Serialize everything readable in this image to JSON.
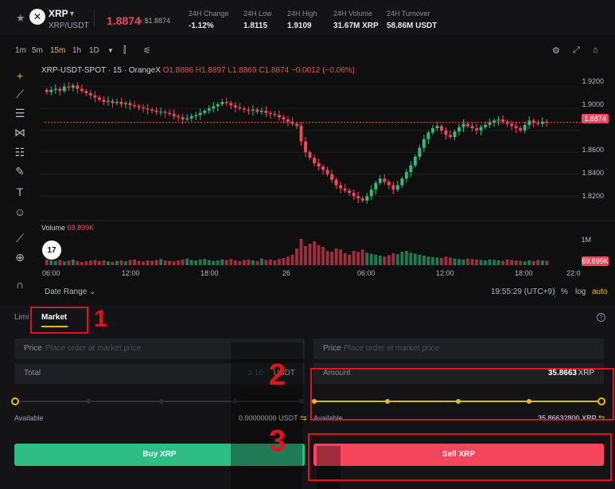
{
  "header": {
    "star_icon": "star-icon",
    "coin_symbol": "XRP",
    "pair_sub": "XRP/USDT",
    "price": "1.8874",
    "price_usd": "≈ $1.8874",
    "stats": [
      {
        "label": "24H Change",
        "value": "-1.12%"
      },
      {
        "label": "24H Low",
        "value": "1.8115"
      },
      {
        "label": "24H High",
        "value": "1.9109"
      },
      {
        "label": "24H Volume",
        "value": "31.67M XRP"
      },
      {
        "label": "24H Turnover",
        "value": "58.86M USDT"
      }
    ]
  },
  "timeframes": [
    "1m",
    "5m",
    "15m",
    "1h",
    "1D"
  ],
  "active_timeframe": "15m",
  "chart": {
    "legend_symbol": "XRP-USDT-SPOT · 15 · OrangeX",
    "legend_values": "O1.8886 H1.8897 L1.8869 C1.8874 −0.0012 (−0.06%)",
    "volume_label": "Volume",
    "volume_value": "69.899K",
    "tv_logo": "17",
    "price_ticks": [
      "1.9200",
      "1.9000",
      "1.8800",
      "1.8600",
      "1.8400",
      "1.8200"
    ],
    "current_price_tag": "1.8874",
    "volume_axis_tick": "1M",
    "volume_tag": "69.899K",
    "time_ticks": [
      "06:00",
      "12:00",
      "18:00",
      "26",
      "06:00",
      "12:00",
      "18:00",
      "22:0"
    ],
    "date_range": "Date Range",
    "clock": "19:55:29 (UTC+9)",
    "pct": "%",
    "log": "log",
    "auto": "auto"
  },
  "chart_data": {
    "type": "candlestick",
    "ylim": [
      1.81,
      1.93
    ],
    "current_price": 1.8874,
    "candles_close": [
      1.915,
      1.917,
      1.918,
      1.916,
      1.92,
      1.919,
      1.921,
      1.918,
      1.916,
      1.914,
      1.912,
      1.91,
      1.908,
      1.906,
      1.907,
      1.905,
      1.906,
      1.904,
      1.905,
      1.903,
      1.902,
      1.901,
      1.9,
      1.899,
      1.898,
      1.897,
      1.897,
      1.896,
      1.895,
      1.893,
      1.892,
      1.89,
      1.891,
      1.893,
      1.894,
      1.896,
      1.898,
      1.9,
      1.902,
      1.904,
      1.906,
      1.905,
      1.903,
      1.901,
      1.9,
      1.899,
      1.898,
      1.899,
      1.897,
      1.898,
      1.896,
      1.895,
      1.894,
      1.892,
      1.89,
      1.888,
      1.886,
      1.884,
      1.87,
      1.86,
      1.855,
      1.85,
      1.847,
      1.844,
      1.84,
      1.835,
      1.83,
      1.827,
      1.825,
      1.823,
      1.82,
      1.818,
      1.816,
      1.82,
      1.826,
      1.832,
      1.836,
      1.833,
      1.83,
      1.826,
      1.83,
      1.836,
      1.842,
      1.848,
      1.856,
      1.864,
      1.872,
      1.878,
      1.882,
      1.884,
      1.88,
      1.876,
      1.874,
      1.879,
      1.883,
      1.886,
      1.884,
      1.882,
      1.88,
      1.883,
      1.885,
      1.887,
      1.889,
      1.89,
      1.888,
      1.886,
      1.884,
      1.882,
      1.88,
      1.885,
      1.889,
      1.887,
      1.886,
      1.888,
      1.887
    ],
    "volumes": [
      0.12,
      0.1,
      0.09,
      0.11,
      0.08,
      0.1,
      0.12,
      0.09,
      0.07,
      0.08,
      0.1,
      0.11,
      0.09,
      0.1,
      0.08,
      0.07,
      0.09,
      0.1,
      0.08,
      0.11,
      0.12,
      0.09,
      0.08,
      0.1,
      0.09,
      0.11,
      0.13,
      0.1,
      0.09,
      0.08,
      0.1,
      0.12,
      0.14,
      0.11,
      0.1,
      0.12,
      0.13,
      0.11,
      0.09,
      0.1,
      0.12,
      0.11,
      0.13,
      0.1,
      0.09,
      0.11,
      0.12,
      0.1,
      0.09,
      0.14,
      0.11,
      0.12,
      0.1,
      0.13,
      0.15,
      0.18,
      0.22,
      0.35,
      0.55,
      0.4,
      0.45,
      0.5,
      0.42,
      0.38,
      0.3,
      0.28,
      0.35,
      0.33,
      0.25,
      0.22,
      0.3,
      0.28,
      0.33,
      0.26,
      0.24,
      0.22,
      0.2,
      0.18,
      0.21,
      0.25,
      0.23,
      0.28,
      0.3,
      0.26,
      0.24,
      0.22,
      0.2,
      0.18,
      0.17,
      0.16,
      0.15,
      0.18,
      0.16,
      0.14,
      0.13,
      0.12,
      0.14,
      0.13,
      0.12,
      0.11,
      0.1,
      0.12,
      0.11,
      0.1,
      0.09,
      0.12,
      0.11,
      0.1,
      0.09,
      0.08,
      0.1,
      0.09,
      0.11,
      0.1,
      0.09,
      0.12
    ]
  },
  "toolbar_icons": [
    "crosshair-icon",
    "trendline-icon",
    "horizontal-lines-icon",
    "pattern-icon",
    "fib-icon",
    "brush-icon",
    "text-icon",
    "emoji-icon",
    "ruler-icon",
    "zoom-in-icon",
    "magnet-icon"
  ],
  "order": {
    "tab_limit": "Limi",
    "tab_market": "Market",
    "info_icon": "?",
    "buy": {
      "price_label": "Price",
      "price_placeholder": "Place order at market price",
      "total_label": "Total",
      "total_hint": "≥ 10",
      "total_unit": "USDT",
      "slider_level": 0,
      "available_label": "Available",
      "available_value": "0.00000000",
      "available_unit": "USDT",
      "button": "Buy XRP"
    },
    "sell": {
      "price_label": "Price",
      "price_placeholder": "Place order at market price",
      "amount_label": "Amount",
      "amount_value": "35.8663",
      "amount_unit": "XRP",
      "slider_level": 1.0,
      "available_label": "Available",
      "available_value": "35.86632800",
      "available_unit": "XRP",
      "button": "Sell XRP"
    }
  },
  "annotations": [
    "1",
    "2",
    "3"
  ],
  "colors": {
    "up": "#2ebd85",
    "down": "#f6465d",
    "accent": "#f0b90b",
    "annotation": "#e0141e"
  }
}
